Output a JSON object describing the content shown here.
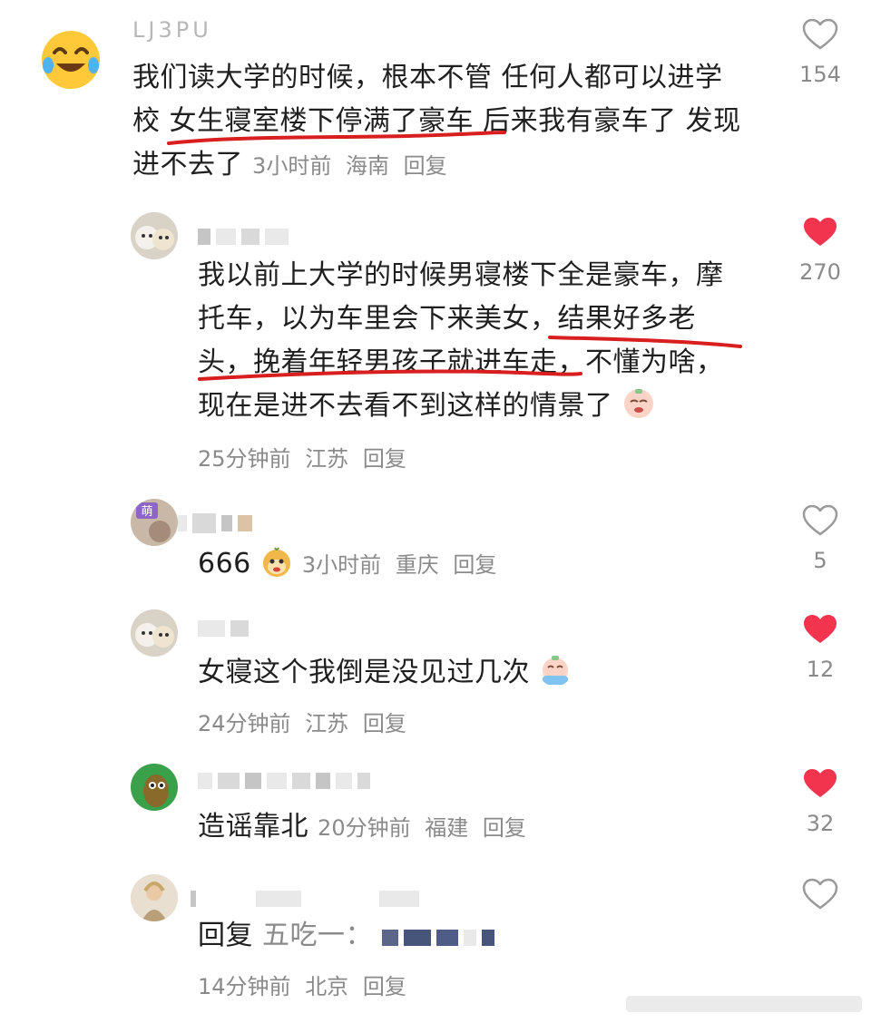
{
  "comments": [
    {
      "username": "LJ3PU",
      "text_line1": "我们读大学的时候，根本不管 任何人都可以进学",
      "text_line2": "校 女生寝室楼下停满了豪车 后来我有豪车了 发现",
      "text_line3": "进不去了",
      "time": "3小时前",
      "location": "海南",
      "reply": "回复",
      "likes": "154",
      "liked": false
    },
    {
      "text_line1": "我以前上大学的时候男寝楼下全是豪车，摩",
      "text_line2": "托车，以为车里会下来美女，结果好多老",
      "text_line3": "头，挽着年轻男孩子就进车走，不懂为啥，",
      "text_line4": "现在是进不去看不到这样的情景了",
      "time": "25分钟前",
      "location": "江苏",
      "reply": "回复",
      "likes": "270",
      "liked": true
    },
    {
      "text": "666",
      "time": "3小时前",
      "location": "重庆",
      "reply": "回复",
      "likes": "5",
      "liked": false,
      "avatar_badge": "萌"
    },
    {
      "text": "女寝这个我倒是没见过几次",
      "time": "24分钟前",
      "location": "江苏",
      "reply": "回复",
      "likes": "12",
      "liked": true
    },
    {
      "text": "造谣靠北",
      "time": "20分钟前",
      "location": "福建",
      "reply": "回复",
      "likes": "32",
      "liked": true
    },
    {
      "reply_prefix": "回复",
      "reply_target": "五吃一：",
      "time": "14分钟前",
      "location": "北京",
      "reply": "回复",
      "liked": false
    }
  ],
  "colors": {
    "liked": "#f2344f",
    "unliked_stroke": "#9a9a9a",
    "annotation": "#d81e1e",
    "meta": "#8a8a8a"
  },
  "icons": [
    "heart-icon",
    "laugh-cry-emoji",
    "cry-emoji",
    "monkey-emoji",
    "tears-emoji"
  ]
}
